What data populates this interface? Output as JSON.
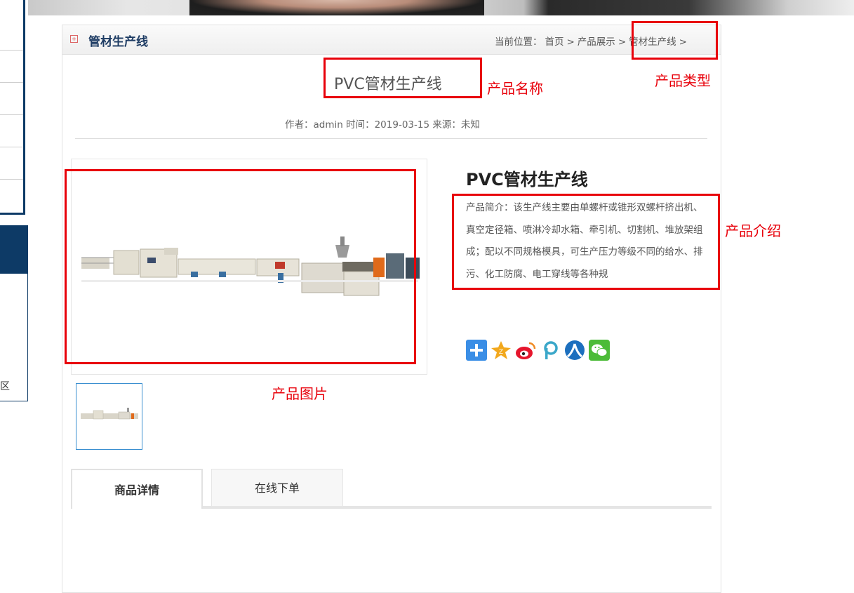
{
  "header": {
    "title": "管材生产线"
  },
  "breadcrumb": {
    "prefix": "当前位置：",
    "items": [
      "首页",
      "产品展示",
      "管材生产线"
    ],
    "separator": ">"
  },
  "product": {
    "name": "PVC管材生产线",
    "meta": "作者：admin 时间：2019-03-15 来源：未知",
    "title": "PVC管材生产线",
    "intro": "产品简介：该生产线主要由单螺杆或锥形双螺杆挤出机、真空定径箱、喷淋冷却水箱、牵引机、切割机、堆放架组成；配以不同规格模具，可生产压力等级不同的给水、排污、化工防腐、电工穿线等各种规"
  },
  "tabs": [
    {
      "label": "商品详情",
      "active": true
    },
    {
      "label": "在线下单",
      "active": false
    }
  ],
  "share_icons": [
    "add-share-icon",
    "qzone-icon",
    "weibo-icon",
    "pengyou-icon",
    "renren-icon",
    "wechat-icon"
  ],
  "sidebar": {
    "fragment_text": "区"
  },
  "annotations": {
    "name": "产品名称",
    "type": "产品类型",
    "intro": "产品介绍",
    "image": "产品图片"
  },
  "colors": {
    "annotation": "#e8000a",
    "sidebar": "#0d3a66",
    "header_title": "#1e3c64"
  }
}
